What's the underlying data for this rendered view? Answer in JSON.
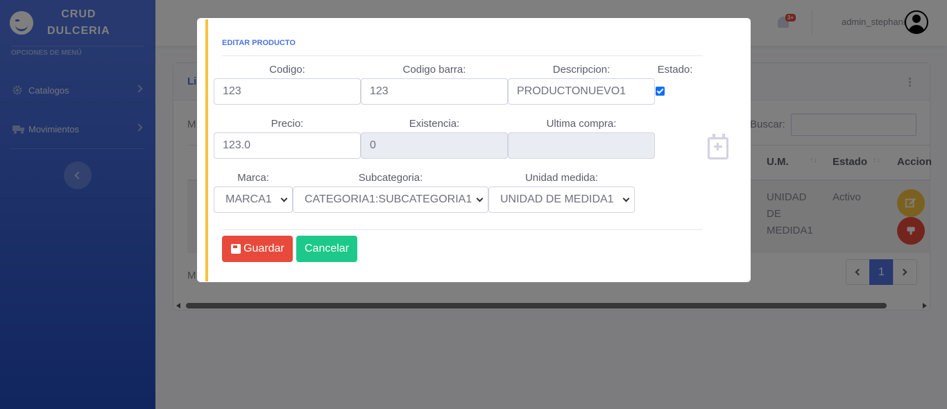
{
  "brand": {
    "line1": "CRUD",
    "line2": "DULCERIA"
  },
  "sidebar": {
    "heading": "OPCIONES DE MENÚ",
    "items": [
      {
        "label": "Catalogos",
        "icon": "gear-icon"
      },
      {
        "label": "Movimientos",
        "icon": "truck-icon"
      }
    ]
  },
  "topbar": {
    "badge": "3+",
    "username": "admin_stephanie"
  },
  "card": {
    "title_partial": "Lis",
    "left_top": "M",
    "left_bottom": "M",
    "search_label": "Buscar:",
    "headers": [
      {
        "label": "U.M."
      },
      {
        "label": "Estado"
      },
      {
        "label": "Accion"
      }
    ],
    "row": {
      "um": [
        "UNIDAD",
        "DE",
        "MEDIDA1"
      ],
      "estado": "Activo"
    },
    "pager": {
      "page": "1"
    }
  },
  "modal": {
    "title": "EDITAR PRODUCTO",
    "fields": {
      "codigo": {
        "label": "Codigo:",
        "value": "123"
      },
      "codigo_barra": {
        "label": "Codigo barra:",
        "value": "123"
      },
      "descripcion": {
        "label": "Descripcion:",
        "value": "PRODUCTONUEVO1"
      },
      "estado": {
        "label": "Estado:",
        "checked": true
      },
      "precio": {
        "label": "Precio:",
        "value": "123.0"
      },
      "existencia": {
        "label": "Existencia:",
        "value": "0"
      },
      "ultima_compra": {
        "label": "Ultima compra:",
        "value": ""
      },
      "marca": {
        "label": "Marca:",
        "value": "MARCA1"
      },
      "subcategoria": {
        "label": "Subcategoria:",
        "value": "CATEGORIA1:SUBCATEGORIA1"
      },
      "unidad_medida": {
        "label": "Unidad medida:",
        "value": "UNIDAD DE MEDIDA1"
      }
    },
    "buttons": {
      "save": "Guardar",
      "cancel": "Cancelar"
    }
  },
  "colors": {
    "primary": "#4e73df",
    "accent_border": "#f6c23e",
    "danger": "#e74a3b",
    "success": "#1cc88a",
    "warning": "#f6c23e"
  }
}
